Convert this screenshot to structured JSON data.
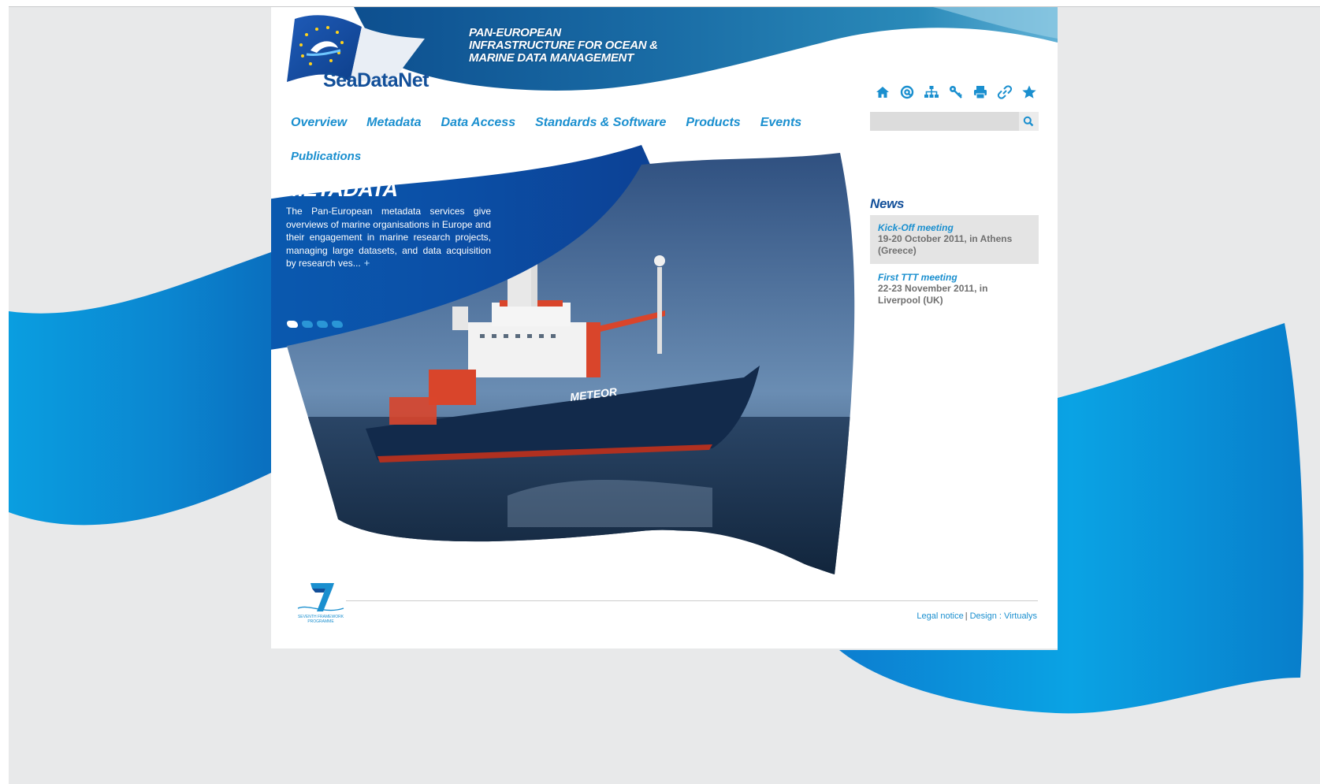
{
  "site": {
    "logo_text": "SeaDataNet",
    "tagline": [
      "PAN-EUROPEAN",
      "INFRASTRUCTURE FOR OCEAN &",
      "MARINE DATA MANAGEMENT"
    ]
  },
  "toolbar": {
    "icons": [
      "home-icon",
      "email-icon",
      "sitemap-icon",
      "key-icon",
      "print-icon",
      "link-icon",
      "favorite-star-icon"
    ]
  },
  "search": {
    "placeholder": "",
    "value": ""
  },
  "nav": {
    "items": [
      "Overview",
      "Metadata",
      "Data Access",
      "Standards & Software",
      "Products",
      "Events"
    ],
    "second_row": "Publications"
  },
  "slide": {
    "title": "METADATA",
    "text": "The Pan-European metadata services give overviews of marine organisations in Europe and their engagement in marine research projects, managing large datasets, and data acquisition by research ves...",
    "more_symbol": "+",
    "ship_name": "METEOR",
    "active_index": 1,
    "count": 4
  },
  "news": {
    "heading": "News",
    "items": [
      {
        "title": "Kick-Off meeting",
        "desc": "19-20 October 2011, in Athens (Greece)"
      },
      {
        "title": "First TTT meeting",
        "desc": "22-23 November 2011, in Liverpool (UK)"
      }
    ]
  },
  "footer": {
    "fp7_caption": "SEVENTH FRAMEWORK PROGRAMME",
    "legal": "Legal notice",
    "design": "Design : Virtualys"
  },
  "colors": {
    "brand_dark": "#124f99",
    "brand_light": "#1a8fcf",
    "background": "#e8e9ea"
  }
}
